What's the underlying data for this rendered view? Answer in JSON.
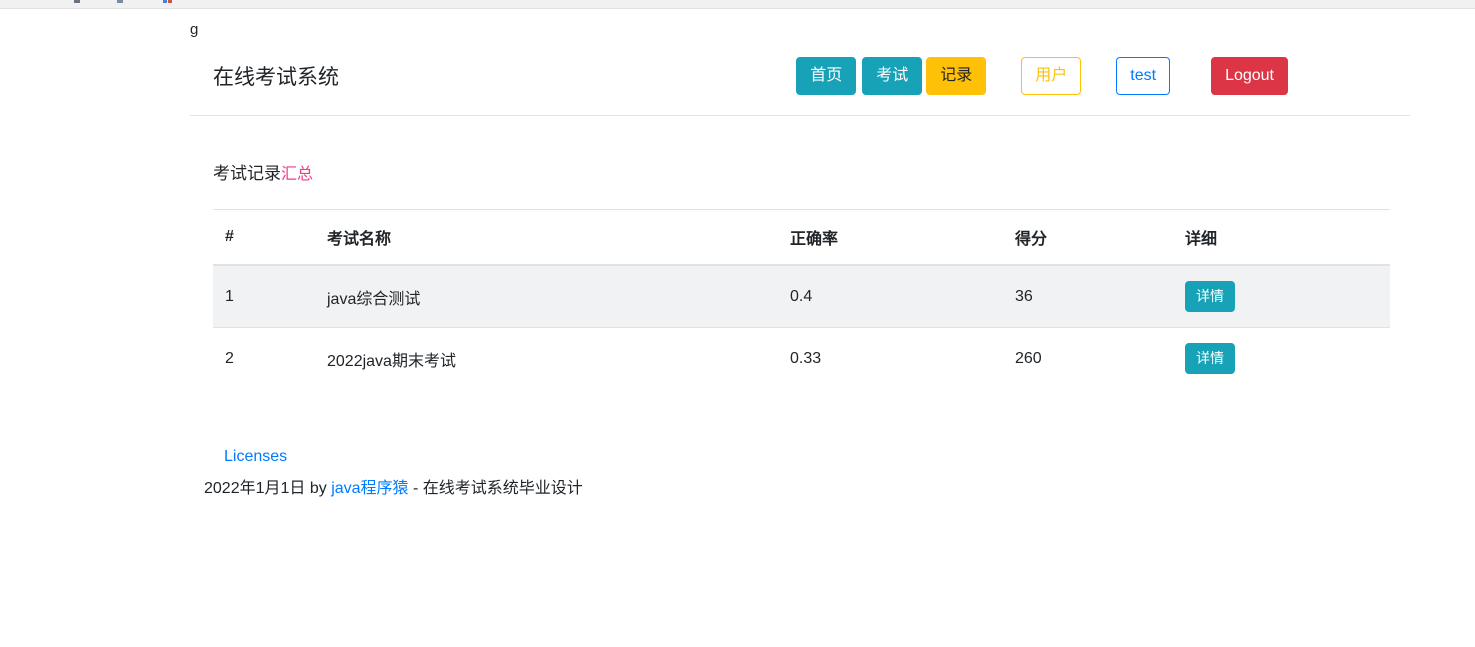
{
  "colors": {
    "teal": "#17a2b8",
    "warning_yellow": "#ffc107",
    "danger_red": "#dc3545",
    "link_blue": "#007bff",
    "code_pink": "#e83e8c",
    "strip_background": "#f1f1f2",
    "stripe_row": "#f1f2f3",
    "table_border": "#dee2e6"
  },
  "stray_text": "g",
  "header": {
    "brand": "在线考试系统",
    "nav": [
      {
        "label": "首页"
      },
      {
        "label": "考试"
      },
      {
        "label": "记录"
      },
      {
        "label": "用户"
      },
      {
        "label": "test"
      },
      {
        "label": "Logout"
      }
    ]
  },
  "heading": {
    "text": "考试记录",
    "code": "汇总"
  },
  "table": {
    "headers": [
      "#",
      "考试名称",
      "正确率",
      "得分",
      "详细"
    ],
    "rows": [
      {
        "index": "1",
        "name": "java综合测试",
        "accuracy": "0.4",
        "score": "36",
        "action": "详情"
      },
      {
        "index": "2",
        "name": "2022java期末考试",
        "accuracy": "0.33",
        "score": "260",
        "action": "详情"
      }
    ]
  },
  "footer": {
    "licenses": "Licenses",
    "byline_prefix": "2022年1月1日 by ",
    "byline_link": "java程序猿",
    "byline_suffix": " - 在线考试系统毕业设计"
  }
}
